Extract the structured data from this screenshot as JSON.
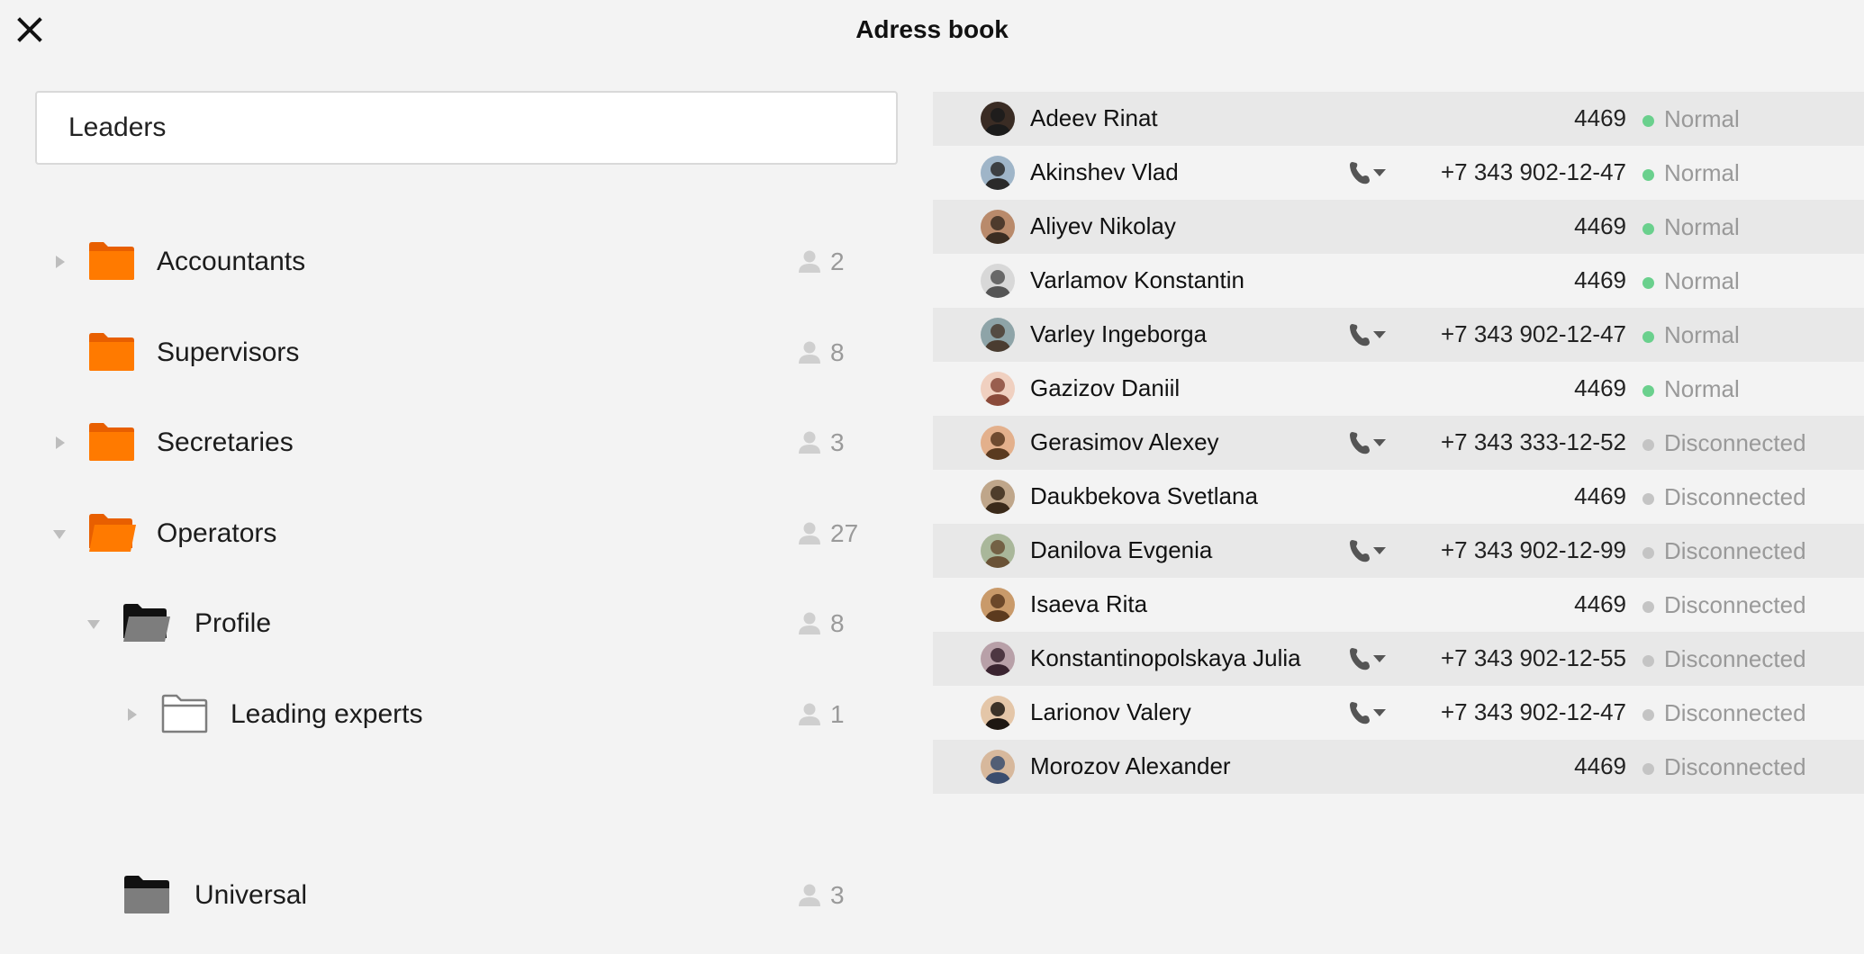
{
  "window": {
    "title": "Adress book",
    "close_icon": "close-icon"
  },
  "search": {
    "value": "Leaders",
    "placeholder": ""
  },
  "colors": {
    "folder_orange": "#ff7a00",
    "folder_black": "#111111",
    "folder_grey": "#7d7d7d",
    "status_online": "#6ad08d",
    "status_offline": "#c4c4c4",
    "shaded_row": "#e8e8e8"
  },
  "groups": [
    {
      "label": "Accountants",
      "count": "2",
      "icon": "folder-orange-icon",
      "expander": "collapsed"
    },
    {
      "label": "Supervisors",
      "count": "8",
      "icon": "folder-orange-icon",
      "expander": "none"
    },
    {
      "label": "Secretaries",
      "count": "3",
      "icon": "folder-orange-icon",
      "expander": "collapsed"
    },
    {
      "label": "Operators",
      "count": "27",
      "icon": "folder-orange-open-icon",
      "expander": "expanded"
    },
    {
      "label": "Profile",
      "count": "8",
      "icon": "folder-black-open-icon",
      "expander": "expanded"
    },
    {
      "label": "Leading experts",
      "count": "1",
      "icon": "folder-outline-icon",
      "expander": "collapsed"
    },
    {
      "label": "Universal",
      "count": "3",
      "icon": "folder-black-icon",
      "expander": "none"
    }
  ],
  "contacts": [
    {
      "name": "Adeev Rinat",
      "phone": "4469",
      "has_call_button": false,
      "status": "Normal"
    },
    {
      "name": "Akinshev Vlad",
      "phone": "+7 343 902-12-47",
      "has_call_button": true,
      "status": "Normal"
    },
    {
      "name": "Aliyev Nikolay",
      "phone": "4469",
      "has_call_button": false,
      "status": "Normal"
    },
    {
      "name": "Varlamov Konstantin",
      "phone": "4469",
      "has_call_button": false,
      "status": "Normal"
    },
    {
      "name": "Varley Ingeborga",
      "phone": "+7 343 902-12-47",
      "has_call_button": true,
      "status": "Normal"
    },
    {
      "name": "Gazizov Daniil",
      "phone": "4469",
      "has_call_button": false,
      "status": "Normal"
    },
    {
      "name": "Gerasimov Alexey",
      "phone": "+7 343 333-12-52",
      "has_call_button": true,
      "status": "Disconnected"
    },
    {
      "name": "Daukbekova Svetlana",
      "phone": "4469",
      "has_call_button": false,
      "status": "Disconnected"
    },
    {
      "name": "Danilova Evgenia",
      "phone": "+7 343 902-12-99",
      "has_call_button": true,
      "status": "Disconnected"
    },
    {
      "name": "Isaeva Rita",
      "phone": "4469",
      "has_call_button": false,
      "status": "Disconnected"
    },
    {
      "name": "Konstantinopolskaya Julia",
      "phone": "+7 343 902-12-55",
      "has_call_button": true,
      "status": "Disconnected"
    },
    {
      "name": "Larionov Valery",
      "phone": "+7 343 902-12-47",
      "has_call_button": true,
      "status": "Disconnected"
    },
    {
      "name": "Morozov Alexander",
      "phone": "4469",
      "has_call_button": false,
      "status": "Disconnected"
    }
  ]
}
